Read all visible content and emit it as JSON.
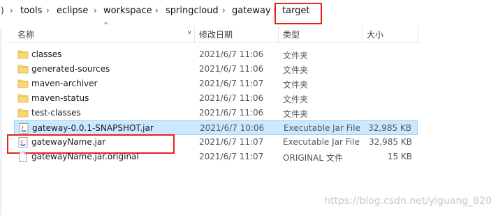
{
  "breadcrumb": {
    "edge": ")",
    "items": [
      "tools",
      "eclipse",
      "workspace",
      "springcloud",
      "gateway",
      "target"
    ],
    "separator": "›"
  },
  "columns": {
    "name": "名称",
    "date": "修改日期",
    "type": "类型",
    "size": "大小"
  },
  "files": [
    {
      "name": "classes",
      "date": "2021/6/7 11:06",
      "type": "文件夹",
      "size": "",
      "icon": "folder-icon"
    },
    {
      "name": "generated-sources",
      "date": "2021/6/7 11:06",
      "type": "文件夹",
      "size": "",
      "icon": "folder-icon"
    },
    {
      "name": "maven-archiver",
      "date": "2021/6/7 11:07",
      "type": "文件夹",
      "size": "",
      "icon": "folder-icon"
    },
    {
      "name": "maven-status",
      "date": "2021/6/7 11:06",
      "type": "文件夹",
      "size": "",
      "icon": "folder-icon"
    },
    {
      "name": "test-classes",
      "date": "2021/6/7 11:06",
      "type": "文件夹",
      "size": "",
      "icon": "folder-icon"
    },
    {
      "name": "gateway-0.0.1-SNAPSHOT.jar",
      "date": "2021/6/7 10:06",
      "type": "Executable Jar File",
      "size": "32,985 KB",
      "icon": "java-jar-icon",
      "selected": true
    },
    {
      "name": "gatewayName.jar",
      "date": "2021/6/7 11:07",
      "type": "Executable Jar File",
      "size": "32,985 KB",
      "icon": "java-jar-icon"
    },
    {
      "name": "gatewayName.jar.original",
      "date": "2021/6/7 11:07",
      "type": "ORIGINAL 文件",
      "size": "15 KB",
      "icon": "file-icon"
    }
  ],
  "watermark": "https://blog.csdn.net/yiguang_820",
  "colors": {
    "highlight": "#e8211c",
    "selection": "#cce8ff",
    "folder": "#f8d775"
  }
}
